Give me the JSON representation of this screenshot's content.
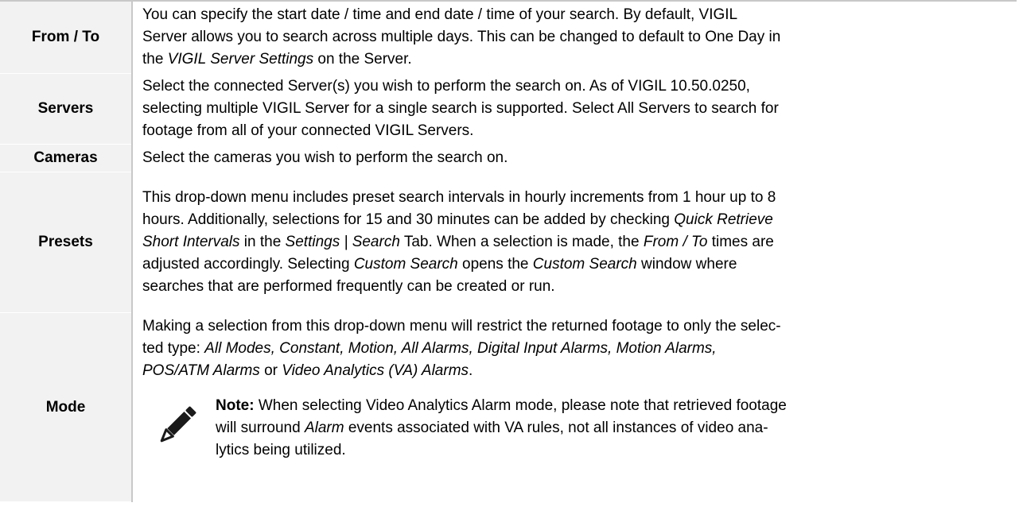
{
  "rows": {
    "from_to": {
      "term": "From / To",
      "line1": "You can specify the start date / time and end date / time of your search. By default, VIGIL",
      "line2": "Server allows you to search across multiple days. This can be changed to default to One Day in",
      "line3_em": "VIGIL Server Settings",
      "line3_pre": "the ",
      "line3_post": " on the Server."
    },
    "servers": {
      "term": "Servers",
      "line1": "Select the connected Server(s) you wish to perform the search on. As of VIGIL 10.50.0250,",
      "line2": "selecting multiple VIGIL Server for a single search is supported. Select All Servers to search for",
      "line3": "footage from all of your connected VIGIL Servers."
    },
    "cameras": {
      "term": "Cameras",
      "line1": "Select the cameras you wish to perform the search on."
    },
    "presets": {
      "term": "Presets",
      "line1": "This drop-down menu includes preset search intervals in hourly increments from 1 hour up to 8",
      "line2_pre": "hours. Additionally, selections for 15 and 30 minutes can be added by checking ",
      "line2_em": "Quick Retrieve",
      "line3_em1": "Short Intervals",
      "line3_mid1": " in the ",
      "line3_em2": "Settings | Search",
      "line3_mid2": " Tab. When a selection is made, the ",
      "line3_em3": "From / To",
      "line3_post": " times are",
      "line4_pre": "adjusted accordingly. Selecting ",
      "line4_em1": "Custom Search",
      "line4_mid": " opens the ",
      "line4_em2": "Custom Search",
      "line4_post": " window where",
      "line5": "searches that are performed frequently can be created or run."
    },
    "mode": {
      "term": "Mode",
      "line1": "Making a selection from this drop-down menu will restrict the returned footage to only the selec-",
      "line2_pre": "ted type: ",
      "line2_em": "All Modes, Constant, Motion, All Alarms, Digital Input Alarms, Motion Alarms,",
      "line3_em1": "POS/ATM Alarms",
      "line3_mid": " or ",
      "line3_em2": "Video Analytics (VA) Alarms",
      "line3_post": ".",
      "note_label": "Note:",
      "note_line1_post": " When selecting Video Analytics Alarm mode, please note that retrieved footage",
      "note_line2_pre": "will surround ",
      "note_line2_em": "Alarm",
      "note_line2_post": " events associated with VA rules, not all instances of video ana-",
      "note_line3": "lytics being utilized."
    }
  },
  "icons": {
    "note": "pencil-icon"
  },
  "colors": {
    "term_bg": "#f2f2f2",
    "border": "#c8c8c8",
    "icon": "#1a1a1a"
  }
}
